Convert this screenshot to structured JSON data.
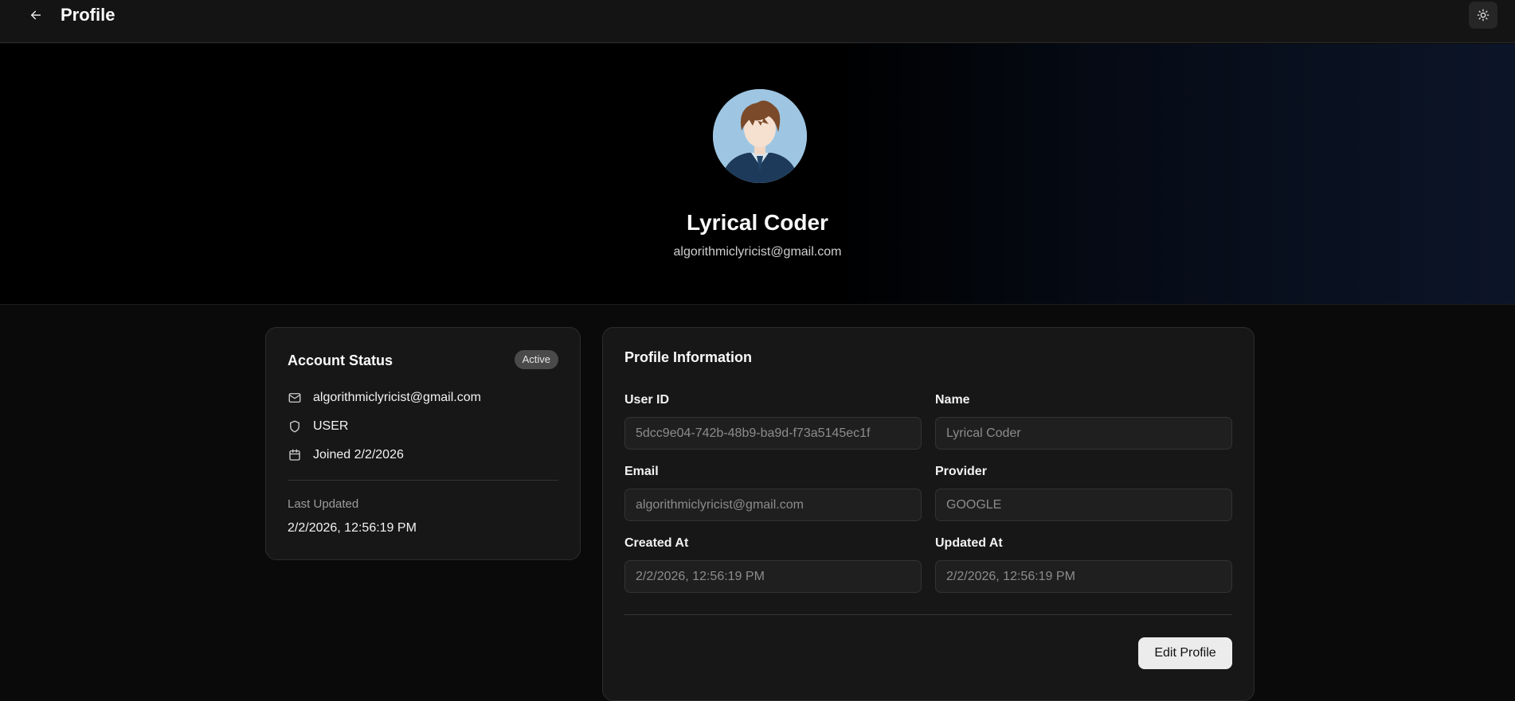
{
  "header": {
    "title": "Profile"
  },
  "hero": {
    "name": "Lyrical Coder",
    "email": "algorithmiclyricist@gmail.com"
  },
  "account_status": {
    "title": "Account Status",
    "badge": "Active",
    "email": "algorithmiclyricist@gmail.com",
    "role": "USER",
    "joined": "Joined 2/2/2026",
    "last_updated_label": "Last Updated",
    "last_updated_value": "2/2/2026, 12:56:19 PM"
  },
  "profile_info": {
    "title": "Profile Information",
    "fields": {
      "user_id": {
        "label": "User ID",
        "value": "5dcc9e04-742b-48b9-ba9d-f73a5145ec1f"
      },
      "name": {
        "label": "Name",
        "value": "Lyrical Coder"
      },
      "email": {
        "label": "Email",
        "value": "algorithmiclyricist@gmail.com"
      },
      "provider": {
        "label": "Provider",
        "value": "GOOGLE"
      },
      "created_at": {
        "label": "Created At",
        "value": "2/2/2026, 12:56:19 PM"
      },
      "updated_at": {
        "label": "Updated At",
        "value": "2/2/2026, 12:56:19 PM"
      }
    },
    "edit_button": "Edit Profile"
  },
  "icons": {
    "back": "arrow-left-icon",
    "theme": "sun-icon",
    "email": "mail-icon",
    "role": "shield-icon",
    "joined": "calendar-icon"
  },
  "colors": {
    "background": "#0a0a0a",
    "card": "#171717",
    "badge": "#4a4a4a",
    "button": "#ececec"
  }
}
